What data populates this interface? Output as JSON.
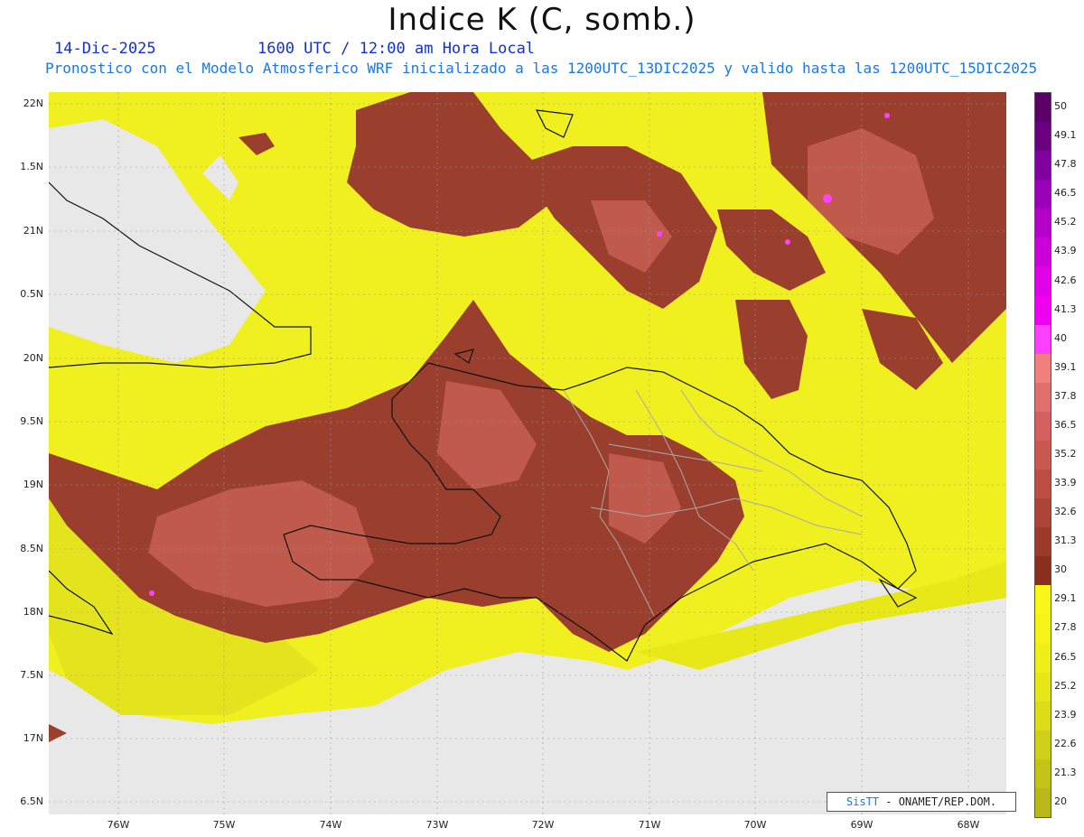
{
  "header": {
    "title": "Indice K (C, somb.)",
    "date": "14-Dic-2025",
    "time": "1600 UTC / 12:00 am Hora Local",
    "model_line": "Pronostico con el Modelo Atmosferico WRF inicializado a las 1200UTC_13DIC2025 y valido hasta las  1200UTC_15DIC2025"
  },
  "axes": {
    "lat_labels": [
      "22N",
      "1.5N",
      "21N",
      "0.5N",
      "20N",
      "9.5N",
      "19N",
      "8.5N",
      "18N",
      "7.5N",
      "17N",
      "6.5N"
    ],
    "lon_labels": [
      "76W",
      "75W",
      "74W",
      "73W",
      "72W",
      "71W",
      "70W",
      "69W",
      "68W"
    ]
  },
  "legend": {
    "labels": [
      "50",
      "49.1",
      "47.8",
      "46.5",
      "45.2",
      "43.9",
      "42.6",
      "41.3",
      "40",
      "39.1",
      "37.8",
      "36.5",
      "35.2",
      "33.9",
      "32.6",
      "31.3",
      "30",
      "29.1",
      "27.8",
      "26.5",
      "25.2",
      "23.9",
      "22.6",
      "21.3",
      "20"
    ],
    "colors": [
      "#5a0066",
      "#6a0080",
      "#8000a0",
      "#9a00b8",
      "#b400c8",
      "#cc00d8",
      "#e000e8",
      "#f000f0",
      "#ff40ff",
      "#f08080",
      "#e07070",
      "#d46060",
      "#c85850",
      "#bc4e44",
      "#ac4438",
      "#9c3a2c",
      "#8a2e1e",
      "#f8f818",
      "#f4f418",
      "#eeee18",
      "#e6e618",
      "#dcdc18",
      "#d0d018",
      "#c4c418",
      "#b8b818"
    ]
  },
  "credit": {
    "brand": "SisTT",
    "text": " - ONAMET/REP.DOM."
  },
  "map_colors": {
    "yellow": "#f0f020",
    "yellow_dark": "#d8d820",
    "brown": "#9a3e2e",
    "brown_light": "#c05a4c",
    "background": "#e8e8e8"
  }
}
